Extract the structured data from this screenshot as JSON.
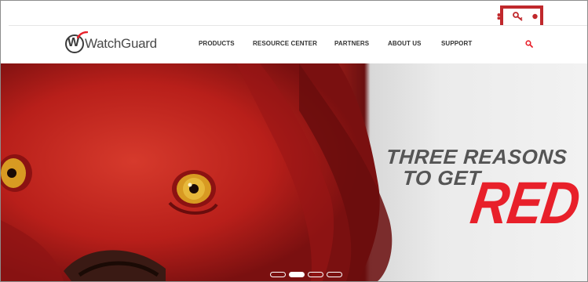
{
  "logo": {
    "text": "WatchGuard"
  },
  "nav": {
    "items": [
      {
        "label": "PRODUCTS"
      },
      {
        "label": "RESOURCE CENTER"
      },
      {
        "label": "PARTNERS"
      },
      {
        "label": "ABOUT US"
      },
      {
        "label": "SUPPORT"
      }
    ],
    "search_icon": "search-icon"
  },
  "utility": {
    "icons": [
      "user-icon",
      "key-icon",
      "globe-icon"
    ]
  },
  "hero": {
    "line1": "THREE REASONS",
    "line2": "TO GET",
    "highlight": "RED",
    "slides_count": 4,
    "active_slide": 2
  },
  "colors": {
    "accent": "#e8202a",
    "highlight_border": "#c0282c",
    "nav_text": "#333333",
    "hero_text": "#555555"
  }
}
